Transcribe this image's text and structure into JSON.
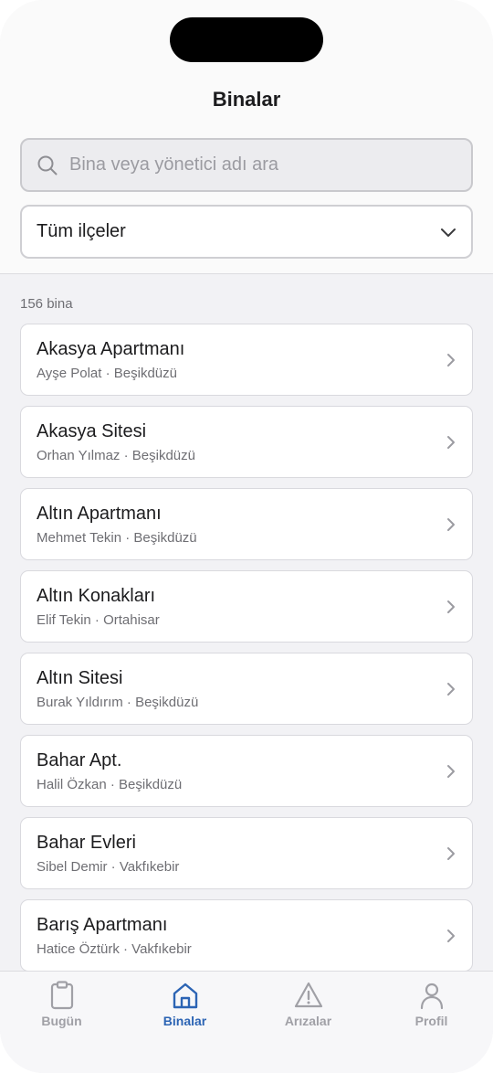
{
  "header": {
    "title": "Binalar"
  },
  "search": {
    "placeholder": "Bina veya yönetici adı ara",
    "value": ""
  },
  "filter": {
    "selected": "Tüm ilçeler"
  },
  "list": {
    "count_label": "156 bina",
    "items": [
      {
        "title": "Akasya Apartmanı",
        "subtitle": "Ayşe Polat · Beşikdüzü"
      },
      {
        "title": "Akasya Sitesi",
        "subtitle": "Orhan Yılmaz · Beşikdüzü"
      },
      {
        "title": "Altın Apartmanı",
        "subtitle": "Mehmet Tekin · Beşikdüzü"
      },
      {
        "title": "Altın Konakları",
        "subtitle": "Elif Tekin · Ortahisar"
      },
      {
        "title": "Altın Sitesi",
        "subtitle": "Burak Yıldırım · Beşikdüzü"
      },
      {
        "title": "Bahar Apt.",
        "subtitle": "Halil Özkan · Beşikdüzü"
      },
      {
        "title": "Bahar Evleri",
        "subtitle": "Sibel Demir · Vakfıkebir"
      },
      {
        "title": "Barış Apartmanı",
        "subtitle": "Hatice Öztürk · Vakfıkebir"
      }
    ]
  },
  "tabbar": {
    "tabs": [
      {
        "label": "Bugün",
        "icon": "clipboard-icon"
      },
      {
        "label": "Binalar",
        "icon": "home-icon"
      },
      {
        "label": "Arızalar",
        "icon": "warning-icon"
      },
      {
        "label": "Profil",
        "icon": "person-icon"
      }
    ],
    "active": "Binalar"
  },
  "colors": {
    "accent": "#2c64b4",
    "inactive": "#a0a0a6"
  }
}
